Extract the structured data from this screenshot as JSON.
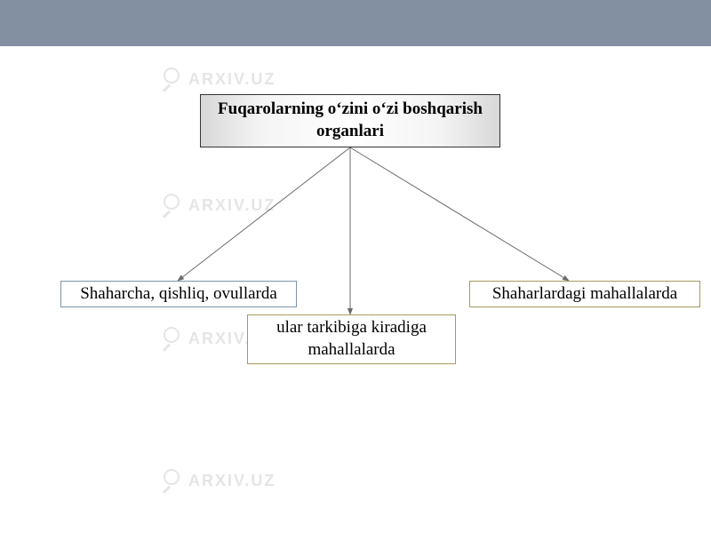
{
  "watermark": {
    "text": "ARXIV.UZ"
  },
  "diagram": {
    "root": {
      "title": "Fuqarolarning oʻzini oʻzi boshqarish organlari"
    },
    "children": {
      "left": {
        "label": "Shaharcha, qishliq, ovullarda"
      },
      "center": {
        "label": "ular tarkibiga kiradiga mahallalarda"
      },
      "right": {
        "label": "Shaharlardagi mahallalarda"
      }
    }
  },
  "colors": {
    "topBand": "#8290a2",
    "rootBorder": "#333333",
    "leftBorder": "#7d93ab",
    "centerBorder": "#a69a5e",
    "rightBorder": "#a69a5e",
    "watermark": "#d0d0d0"
  }
}
